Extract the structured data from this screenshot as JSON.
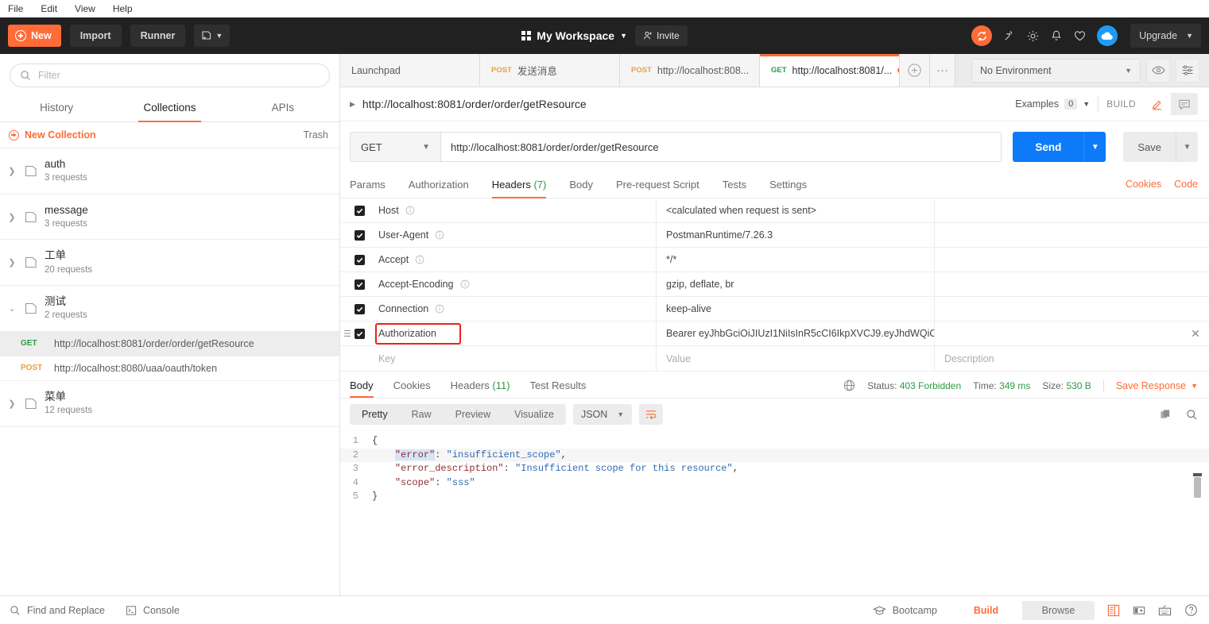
{
  "menubar": {
    "items": [
      "File",
      "Edit",
      "View",
      "Help"
    ]
  },
  "toolbar": {
    "new_label": "New",
    "import_label": "Import",
    "runner_label": "Runner",
    "new_window_icon": "new-window-icon",
    "workspace_label": "My Workspace",
    "invite_label": "Invite",
    "upgrade_label": "Upgrade",
    "icons": [
      "sync-icon",
      "satellite-icon",
      "gear-icon",
      "bell-icon",
      "heart-icon",
      "cloud-icon"
    ]
  },
  "sidebar": {
    "filter_placeholder": "Filter",
    "tabs": [
      {
        "label": "History",
        "active": false
      },
      {
        "label": "Collections",
        "active": true
      },
      {
        "label": "APIs",
        "active": false
      }
    ],
    "new_collection_label": "New Collection",
    "trash_label": "Trash",
    "collections": [
      {
        "name": "auth",
        "sub": "3 requests",
        "expanded": false
      },
      {
        "name": "message",
        "sub": "3 requests",
        "expanded": false
      },
      {
        "name": "工单",
        "sub": "20 requests",
        "expanded": false
      },
      {
        "name": "测试",
        "sub": "2 requests",
        "expanded": true
      },
      {
        "name": "菜单",
        "sub": "12 requests",
        "expanded": false
      }
    ],
    "requests": [
      {
        "method": "GET",
        "url": "http://localhost:8081/order/order/getResource",
        "selected": true
      },
      {
        "method": "POST",
        "url": "http://localhost:8080/uaa/oauth/token",
        "selected": false
      }
    ]
  },
  "tabstrip": {
    "tabs": [
      {
        "method": "",
        "label": "Launchpad",
        "active": false,
        "unsaved": false
      },
      {
        "method": "POST",
        "label": "发送消息",
        "active": false,
        "unsaved": false
      },
      {
        "method": "POST",
        "label": "http://localhost:808...",
        "active": false,
        "unsaved": false
      },
      {
        "method": "GET",
        "label": "http://localhost:8081/...",
        "active": true,
        "unsaved": true
      }
    ],
    "add_tab_icon": "plus-circle-icon",
    "more_icon": "ellipsis-icon",
    "environment": "No Environment",
    "eye_icon": "eye-icon",
    "settings_icon": "sliders-icon"
  },
  "request": {
    "title": "http://localhost:8081/order/order/getResource",
    "examples_label": "Examples",
    "examples_count": "0",
    "build_label": "BUILD",
    "edit_icon": "pencil-icon",
    "comment_icon": "comment-icon",
    "method": "GET",
    "url": "http://localhost:8081/order/order/getResource",
    "send_label": "Send",
    "save_label": "Save",
    "tabs": [
      {
        "label": "Params",
        "count": "",
        "active": false
      },
      {
        "label": "Authorization",
        "count": "",
        "active": false
      },
      {
        "label": "Headers",
        "count": "(7)",
        "active": true
      },
      {
        "label": "Body",
        "count": "",
        "active": false
      },
      {
        "label": "Pre-request Script",
        "count": "",
        "active": false
      },
      {
        "label": "Tests",
        "count": "",
        "active": false
      },
      {
        "label": "Settings",
        "count": "",
        "active": false
      }
    ],
    "cookies_link": "Cookies",
    "code_link": "Code"
  },
  "headers_table": {
    "columns": {
      "key": "Key",
      "value": "Value",
      "description": "Description"
    },
    "rows": [
      {
        "checked": true,
        "key": "Host",
        "info": true,
        "value": "<calculated when request is sent>",
        "description": "",
        "highlighted": false
      },
      {
        "checked": true,
        "key": "User-Agent",
        "info": true,
        "value": "PostmanRuntime/7.26.3",
        "description": "",
        "highlighted": false
      },
      {
        "checked": true,
        "key": "Accept",
        "info": true,
        "value": "*/*",
        "description": "",
        "highlighted": false
      },
      {
        "checked": true,
        "key": "Accept-Encoding",
        "info": true,
        "value": "gzip, deflate, br",
        "description": "",
        "highlighted": false
      },
      {
        "checked": true,
        "key": "Connection",
        "info": true,
        "value": "keep-alive",
        "description": "",
        "highlighted": false
      },
      {
        "checked": true,
        "key": "Authorization",
        "info": false,
        "value": "Bearer eyJhbGciOiJIUzI1NiIsInR5cCI6IkpXVCJ9.eyJhdWQiO…",
        "description": "",
        "highlighted": true
      }
    ],
    "highlight_color": "#e8231c"
  },
  "response": {
    "tabs": [
      {
        "label": "Body",
        "count": "",
        "active": true
      },
      {
        "label": "Cookies",
        "count": "",
        "active": false
      },
      {
        "label": "Headers",
        "count": "(11)",
        "active": false
      },
      {
        "label": "Test Results",
        "count": "",
        "active": false
      }
    ],
    "status_label": "Status:",
    "status_value": "403 Forbidden",
    "time_label": "Time:",
    "time_value": "349 ms",
    "size_label": "Size:",
    "size_value": "530 B",
    "save_response_label": "Save Response",
    "view_modes": [
      {
        "label": "Pretty",
        "active": true
      },
      {
        "label": "Raw",
        "active": false
      },
      {
        "label": "Preview",
        "active": false
      },
      {
        "label": "Visualize",
        "active": false
      }
    ],
    "format": "JSON",
    "wrap_icon": "word-wrap-icon",
    "copy_icon": "copy-icon",
    "search_icon": "search-icon",
    "body_lines": [
      {
        "n": "1",
        "parts": [
          {
            "t": "{",
            "c": "pun"
          }
        ]
      },
      {
        "n": "2",
        "highlight": true,
        "parts": [
          {
            "t": "    ",
            "c": "pun"
          },
          {
            "t": "\"error\"",
            "c": "key sel"
          },
          {
            "t": ": ",
            "c": "pun"
          },
          {
            "t": "\"insufficient_scope\"",
            "c": "str"
          },
          {
            "t": ",",
            "c": "pun"
          }
        ]
      },
      {
        "n": "3",
        "parts": [
          {
            "t": "    ",
            "c": "pun"
          },
          {
            "t": "\"error_description\"",
            "c": "key"
          },
          {
            "t": ": ",
            "c": "pun"
          },
          {
            "t": "\"Insufficient scope for this resource\"",
            "c": "str"
          },
          {
            "t": ",",
            "c": "pun"
          }
        ]
      },
      {
        "n": "4",
        "parts": [
          {
            "t": "    ",
            "c": "pun"
          },
          {
            "t": "\"scope\"",
            "c": "key"
          },
          {
            "t": ": ",
            "c": "pun"
          },
          {
            "t": "\"sss\"",
            "c": "str"
          }
        ]
      },
      {
        "n": "5",
        "parts": [
          {
            "t": "}",
            "c": "pun"
          }
        ]
      }
    ]
  },
  "footer": {
    "find_replace_label": "Find and Replace",
    "console_label": "Console",
    "bootcamp_label": "Bootcamp",
    "build_label": "Build",
    "browse_label": "Browse",
    "icons": [
      "two-pane-icon",
      "split-pane-icon",
      "keyboard-icon",
      "help-icon"
    ]
  }
}
